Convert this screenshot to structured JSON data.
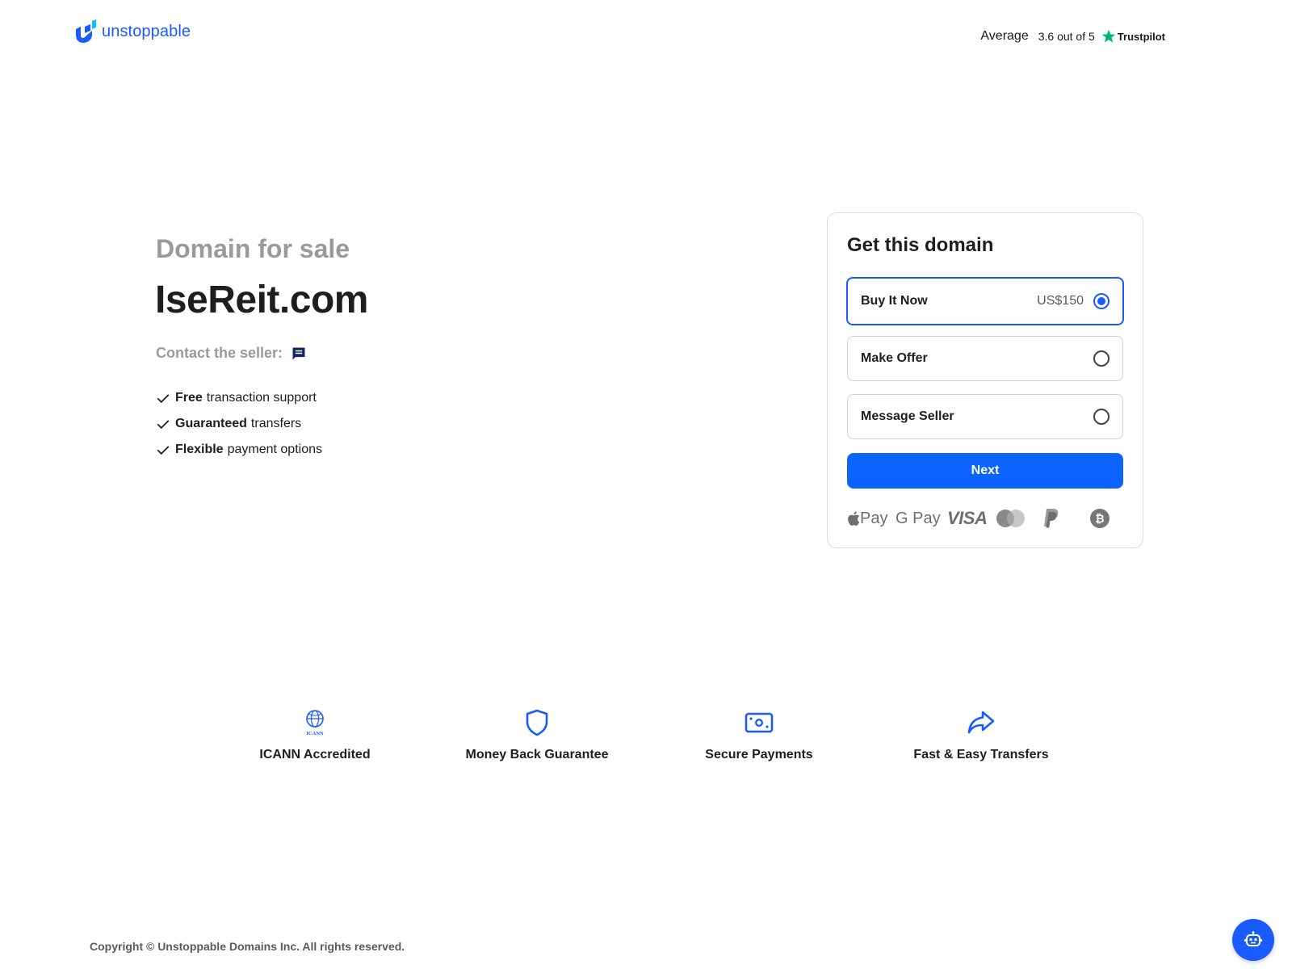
{
  "header": {
    "logo_text": "unstoppable",
    "rating_label": "Average",
    "rating_score": "3.6 out of 5",
    "rating_source": "Trustpilot"
  },
  "hero": {
    "subtitle": "Domain for sale",
    "domain": "IseReit.com",
    "contact_label": "Contact the seller:",
    "features": [
      {
        "bold": "Free",
        "rest": "transaction support"
      },
      {
        "bold": "Guaranteed",
        "rest": "transfers"
      },
      {
        "bold": "Flexible",
        "rest": "payment options"
      }
    ]
  },
  "card": {
    "title": "Get this domain",
    "options": [
      {
        "label": "Buy It Now",
        "price": "US$150",
        "selected": true
      },
      {
        "label": "Make Offer",
        "price": "",
        "selected": false
      },
      {
        "label": "Message Seller",
        "price": "",
        "selected": false
      }
    ],
    "next_label": "Next",
    "payments": {
      "apple": "Pay",
      "google": "G Pay",
      "visa": "VISA",
      "icons": [
        "apple-pay-icon",
        "google-pay-icon",
        "visa-icon",
        "mastercard-icon",
        "paypal-icon",
        "bitcoin-icon"
      ]
    }
  },
  "trust": [
    {
      "label": "ICANN Accredited",
      "icon": "icann-icon",
      "icon_text": "ICANN"
    },
    {
      "label": "Money Back Guarantee",
      "icon": "shield-icon"
    },
    {
      "label": "Secure Payments",
      "icon": "cash-icon"
    },
    {
      "label": "Fast & Easy Transfers",
      "icon": "share-arrow-icon"
    }
  ],
  "footer": {
    "copyright": "Copyright © Unstoppable Domains Inc. All rights reserved."
  },
  "colors": {
    "brand": "#1a5bff",
    "button": "#0d63ff",
    "trustpilot": "#00b67a",
    "muted": "#9a9a9a"
  }
}
